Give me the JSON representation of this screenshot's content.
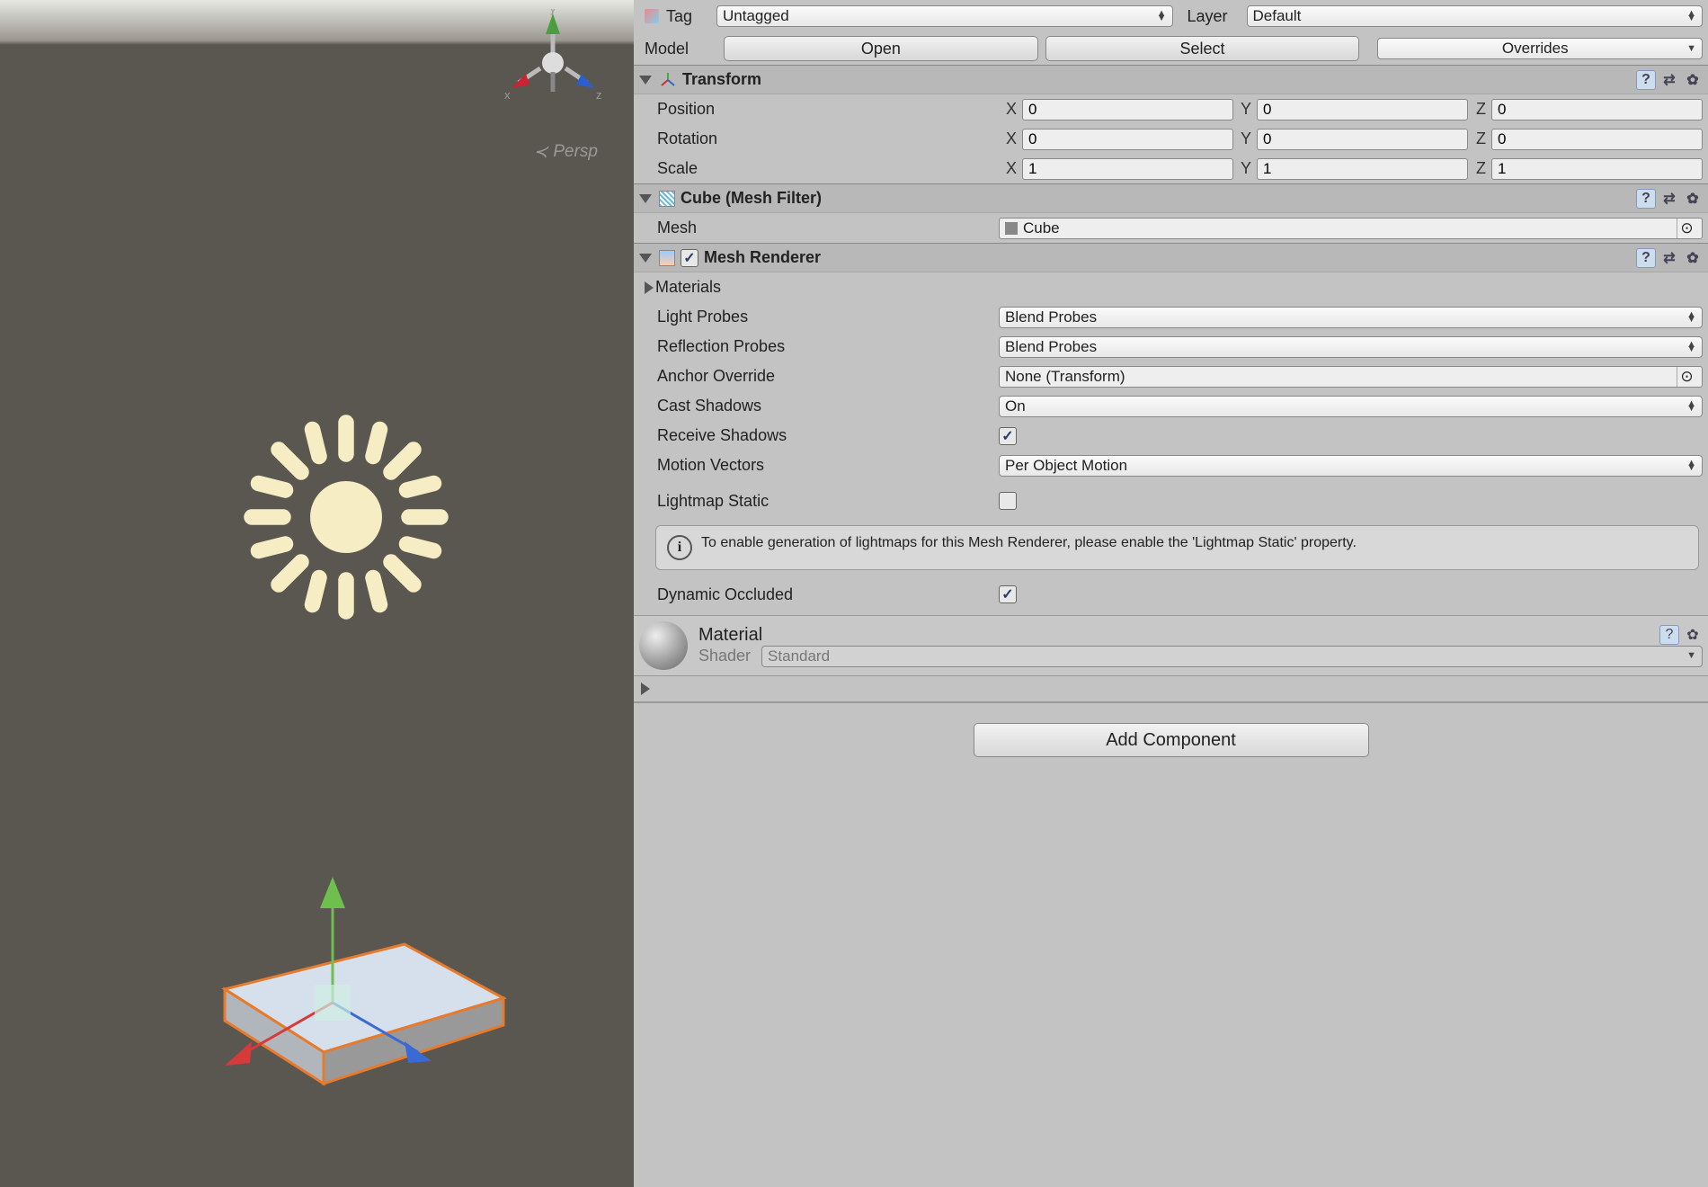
{
  "scene": {
    "persp_label": "Persp",
    "axis": {
      "x": "x",
      "y": "y",
      "z": "z"
    }
  },
  "header": {
    "tag_label": "Tag",
    "tag_value": "Untagged",
    "layer_label": "Layer",
    "layer_value": "Default",
    "model_label": "Model",
    "open": "Open",
    "select": "Select",
    "overrides": "Overrides"
  },
  "transform": {
    "title": "Transform",
    "position": {
      "label": "Position",
      "x": "0",
      "y": "0",
      "z": "0"
    },
    "rotation": {
      "label": "Rotation",
      "x": "0",
      "y": "0",
      "z": "0"
    },
    "scale": {
      "label": "Scale",
      "x": "1",
      "y": "1",
      "z": "1"
    },
    "axis": {
      "x": "X",
      "y": "Y",
      "z": "Z"
    }
  },
  "meshfilter": {
    "title": "Cube (Mesh Filter)",
    "mesh_label": "Mesh",
    "mesh_value": "Cube"
  },
  "renderer": {
    "title": "Mesh Renderer",
    "materials": "Materials",
    "light_probes": {
      "label": "Light Probes",
      "value": "Blend Probes"
    },
    "reflection_probes": {
      "label": "Reflection Probes",
      "value": "Blend Probes"
    },
    "anchor": {
      "label": "Anchor Override",
      "value": "None (Transform)"
    },
    "cast": {
      "label": "Cast Shadows",
      "value": "On"
    },
    "receive": {
      "label": "Receive Shadows",
      "checked": true
    },
    "motion": {
      "label": "Motion Vectors",
      "value": "Per Object Motion"
    },
    "lightmap": {
      "label": "Lightmap Static",
      "checked": false
    },
    "info": "To enable generation of lightmaps for this Mesh Renderer, please enable the 'Lightmap Static' property.",
    "dynamic": {
      "label": "Dynamic Occluded",
      "checked": true
    }
  },
  "material": {
    "title": "Material",
    "shader_label": "Shader",
    "shader_value": "Standard"
  },
  "add_component": "Add Component"
}
